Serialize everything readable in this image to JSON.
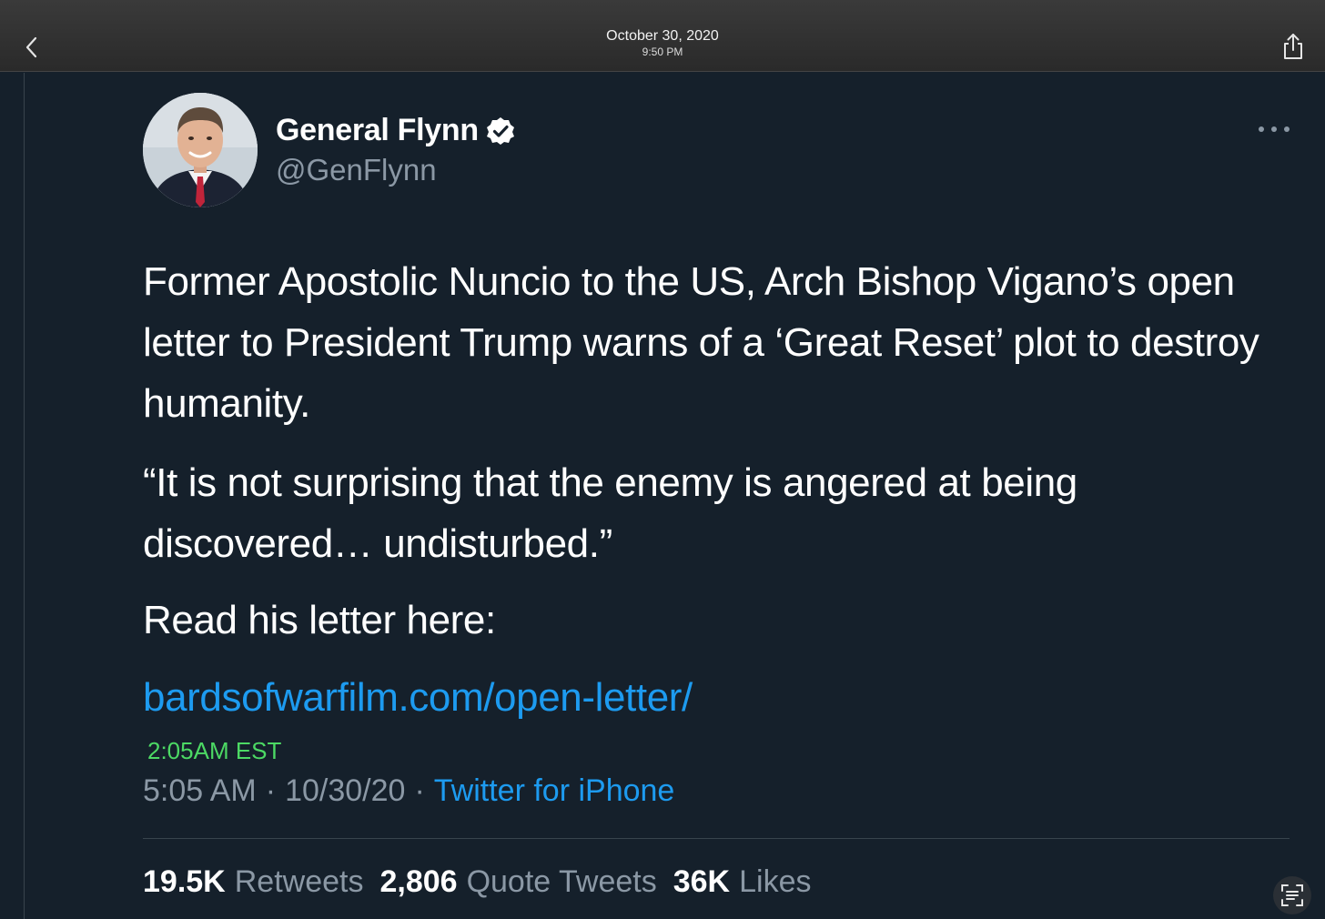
{
  "header": {
    "date": "October 30, 2020",
    "time": "9:50 PM",
    "back_icon": "chevron-left-icon",
    "share_icon": "share-icon"
  },
  "tweet": {
    "author_name": "General Flynn",
    "handle": "@GenFlynn",
    "verified": true,
    "paragraphs": [
      "Former Apostolic Nuncio to the US, Arch Bishop Vigano’s open letter to President Trump warns of a ‘Great Reset’ plot to destroy humanity.",
      "“It is not surprising that the enemy is angered at being discovered… undisturbed.”",
      "Read his letter here:"
    ],
    "link": "bardsofwarfilm.com/open-letter/",
    "overlay_time": "2:05AM EST",
    "post_time": "5:05 AM",
    "post_date": "10/30/20",
    "separator": "·",
    "source": "Twitter for iPhone"
  },
  "stats": [
    {
      "value": "19.5K",
      "label": "Retweets"
    },
    {
      "value": "2,806",
      "label": "Quote Tweets"
    },
    {
      "value": "36K",
      "label": "Likes"
    }
  ],
  "colors": {
    "background": "#15202b",
    "link": "#1d9bf0",
    "secondary_text": "#8b98a5",
    "overlay_time": "#4cd964"
  }
}
